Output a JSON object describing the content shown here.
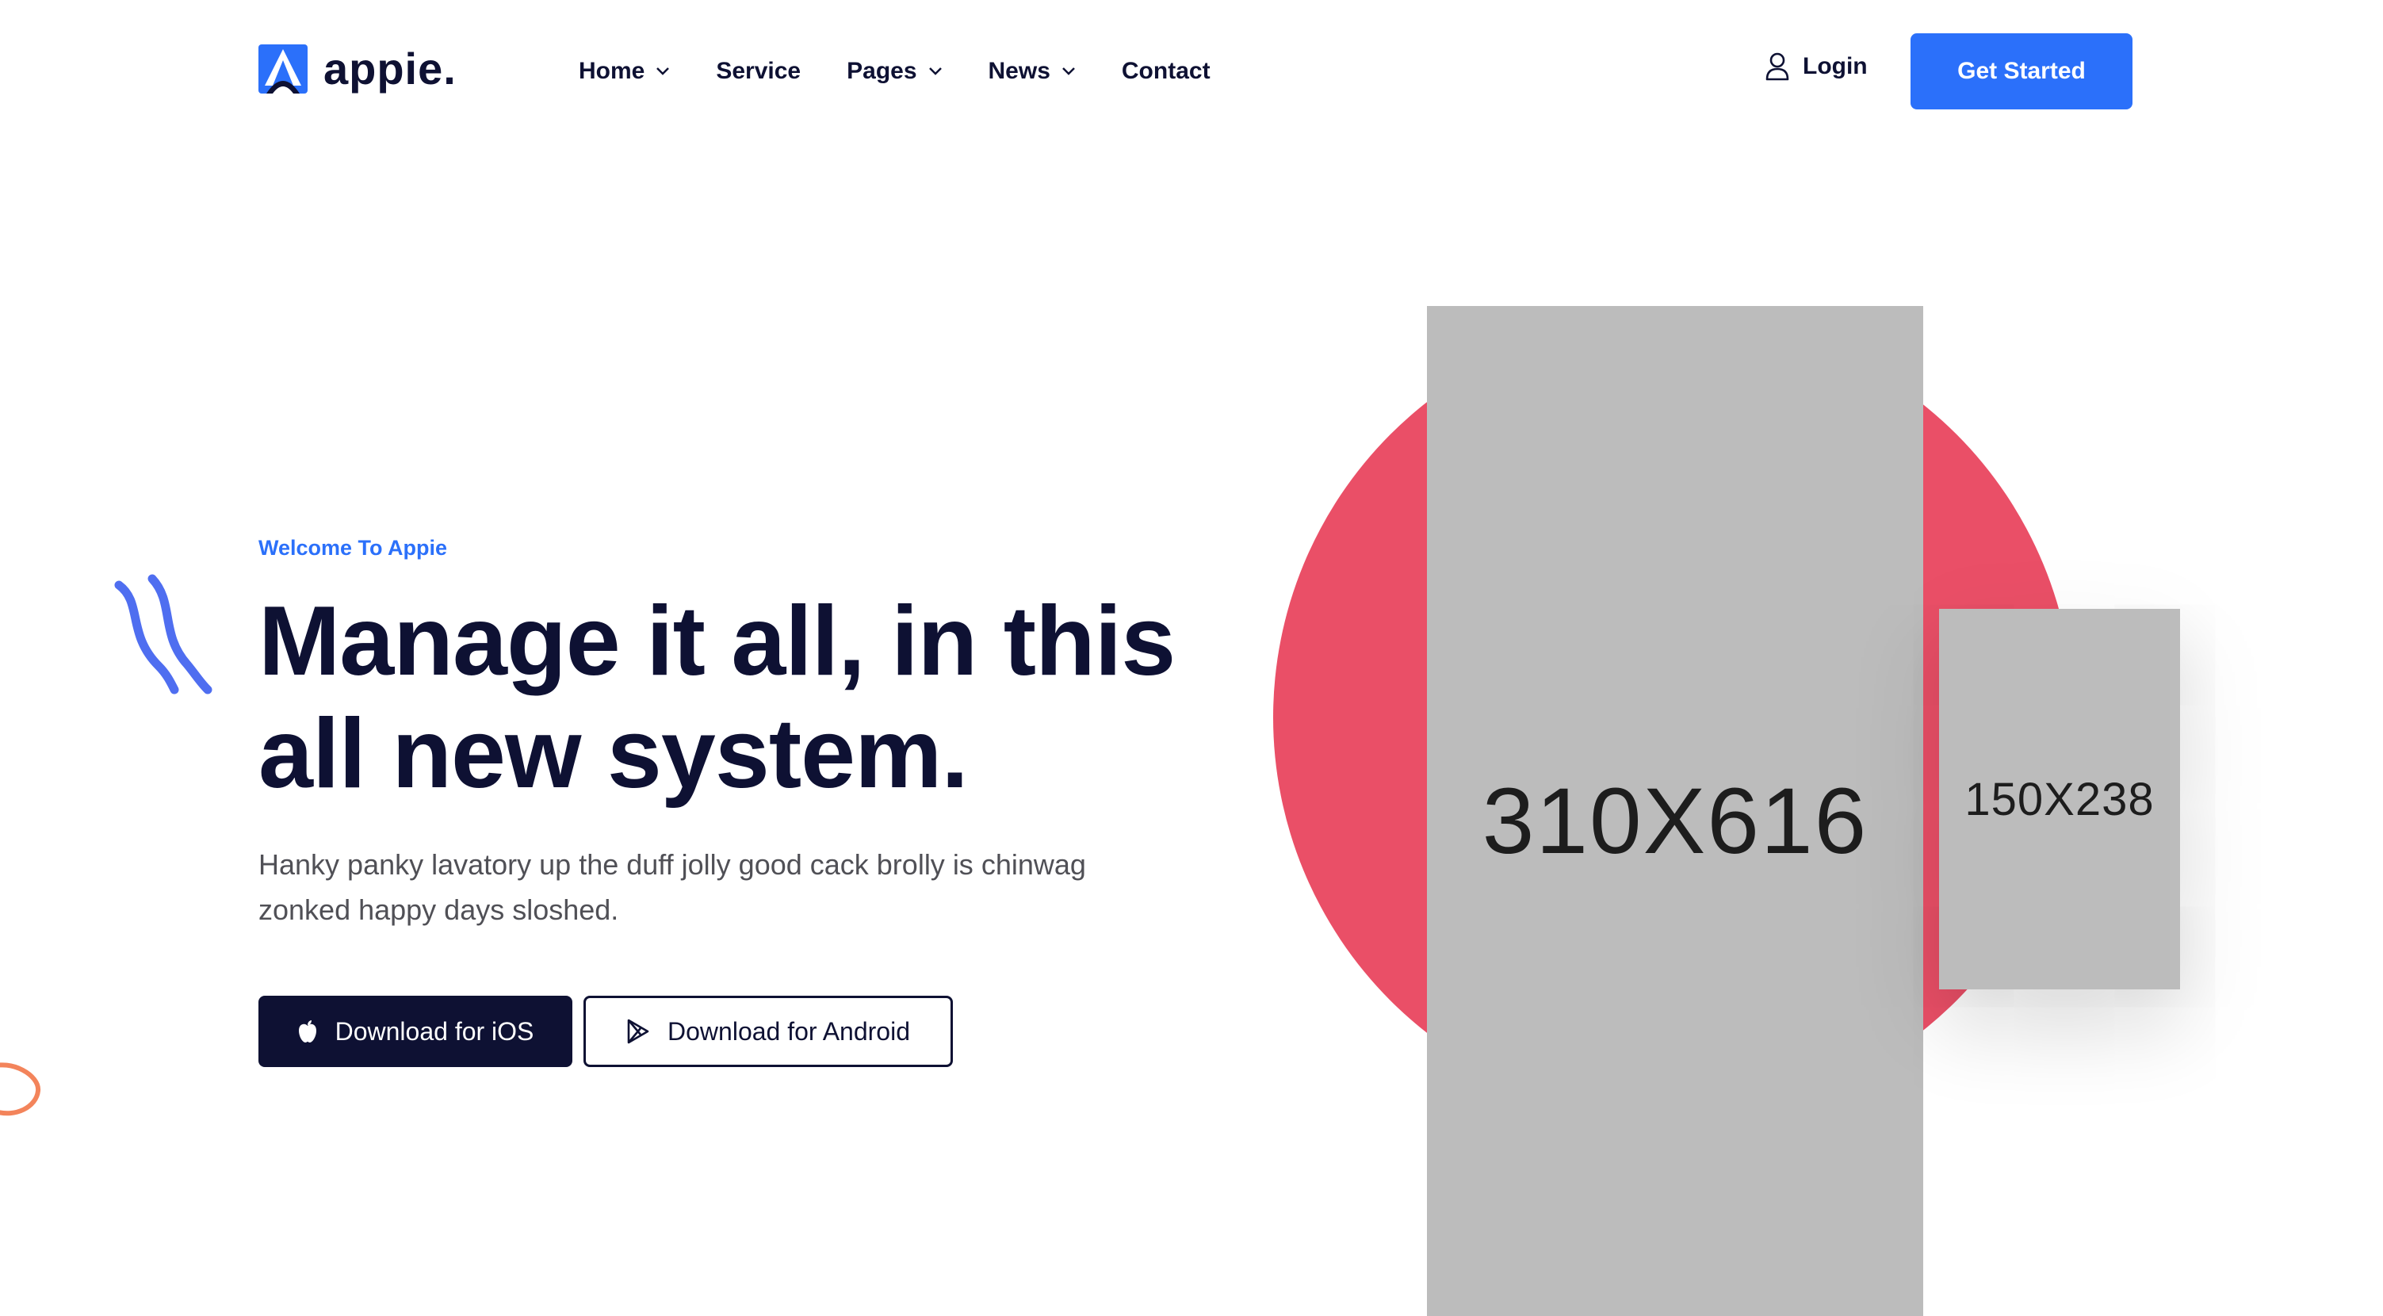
{
  "brand": {
    "name": "appie.",
    "accent": "#2b70fa",
    "dark": "#0e1133"
  },
  "nav": {
    "items": [
      {
        "label": "Home",
        "dropdown": true
      },
      {
        "label": "Service",
        "dropdown": false
      },
      {
        "label": "Pages",
        "dropdown": true
      },
      {
        "label": "News",
        "dropdown": true
      },
      {
        "label": "Contact",
        "dropdown": false
      }
    ],
    "login_label": "Login",
    "login_icon": "user-icon",
    "cta_label": "Get Started"
  },
  "hero": {
    "eyebrow": "Welcome To Appie",
    "title_line1": "Manage it all, in this",
    "title_line2": "all new system.",
    "description": "Hanky panky lavatory up the duff jolly good cack brolly is chinwag zonked happy days sloshed.",
    "buttons": {
      "ios_label": "Download for iOS",
      "ios_icon": "apple-icon",
      "android_label": "Download for Android",
      "android_icon": "play-store-icon"
    },
    "images": {
      "main_placeholder": "310X616",
      "small_placeholder": "150X238",
      "circle_color": "#ea4f67"
    }
  }
}
